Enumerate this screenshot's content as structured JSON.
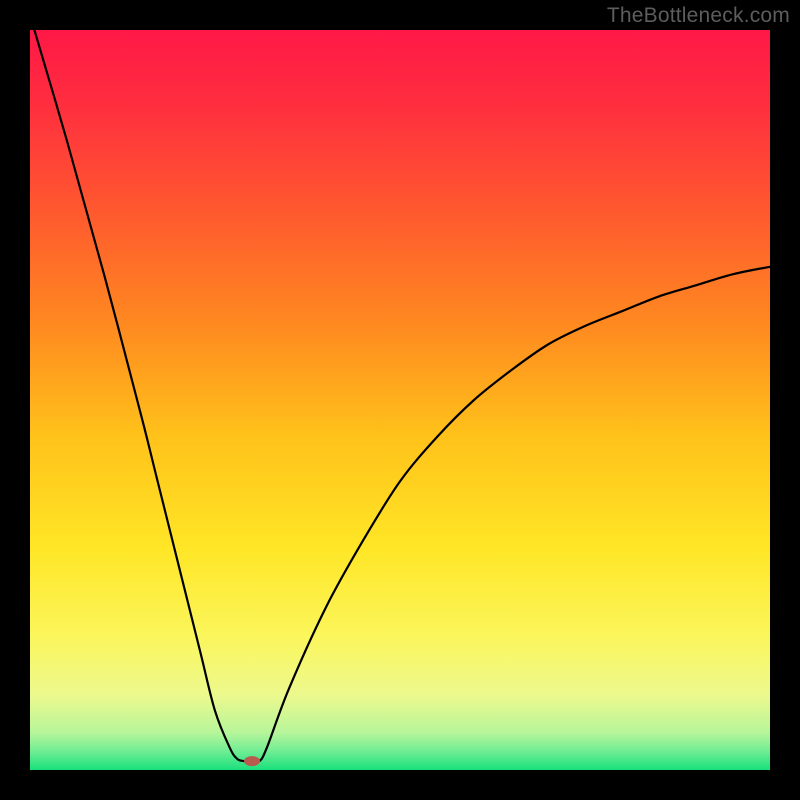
{
  "watermark": "TheBottleneck.com",
  "chart_data": {
    "type": "line",
    "title": "",
    "xlabel": "",
    "ylabel": "",
    "xlim": [
      0,
      100
    ],
    "ylim": [
      0,
      100
    ],
    "grid": false,
    "series": [
      {
        "name": "bottleneck-curve",
        "x": [
          0,
          5,
          10,
          15,
          17,
          20,
          23,
          25,
          27,
          28,
          29,
          30,
          31,
          32,
          35,
          40,
          45,
          50,
          55,
          60,
          65,
          70,
          75,
          80,
          85,
          90,
          95,
          100
        ],
        "values": [
          102,
          85,
          67,
          48,
          40,
          28,
          16,
          8,
          3,
          1.5,
          1.2,
          1.2,
          1.2,
          3,
          11,
          22,
          31,
          39,
          45,
          50,
          54,
          57.5,
          60,
          62,
          64,
          65.5,
          67,
          68
        ]
      }
    ],
    "marker": {
      "x": 30,
      "y": 1.2,
      "color": "#b85a4d",
      "rx": 8,
      "ry": 5
    },
    "background_gradient": {
      "stops": [
        {
          "offset": 0.0,
          "color": "#ff1846"
        },
        {
          "offset": 0.1,
          "color": "#ff2e3f"
        },
        {
          "offset": 0.25,
          "color": "#ff5a2e"
        },
        {
          "offset": 0.4,
          "color": "#ff8a20"
        },
        {
          "offset": 0.55,
          "color": "#ffc21a"
        },
        {
          "offset": 0.7,
          "color": "#ffe626"
        },
        {
          "offset": 0.82,
          "color": "#fbf65c"
        },
        {
          "offset": 0.9,
          "color": "#ecf98e"
        },
        {
          "offset": 0.95,
          "color": "#b6f59a"
        },
        {
          "offset": 0.975,
          "color": "#6fed94"
        },
        {
          "offset": 1.0,
          "color": "#18e07c"
        }
      ]
    }
  }
}
